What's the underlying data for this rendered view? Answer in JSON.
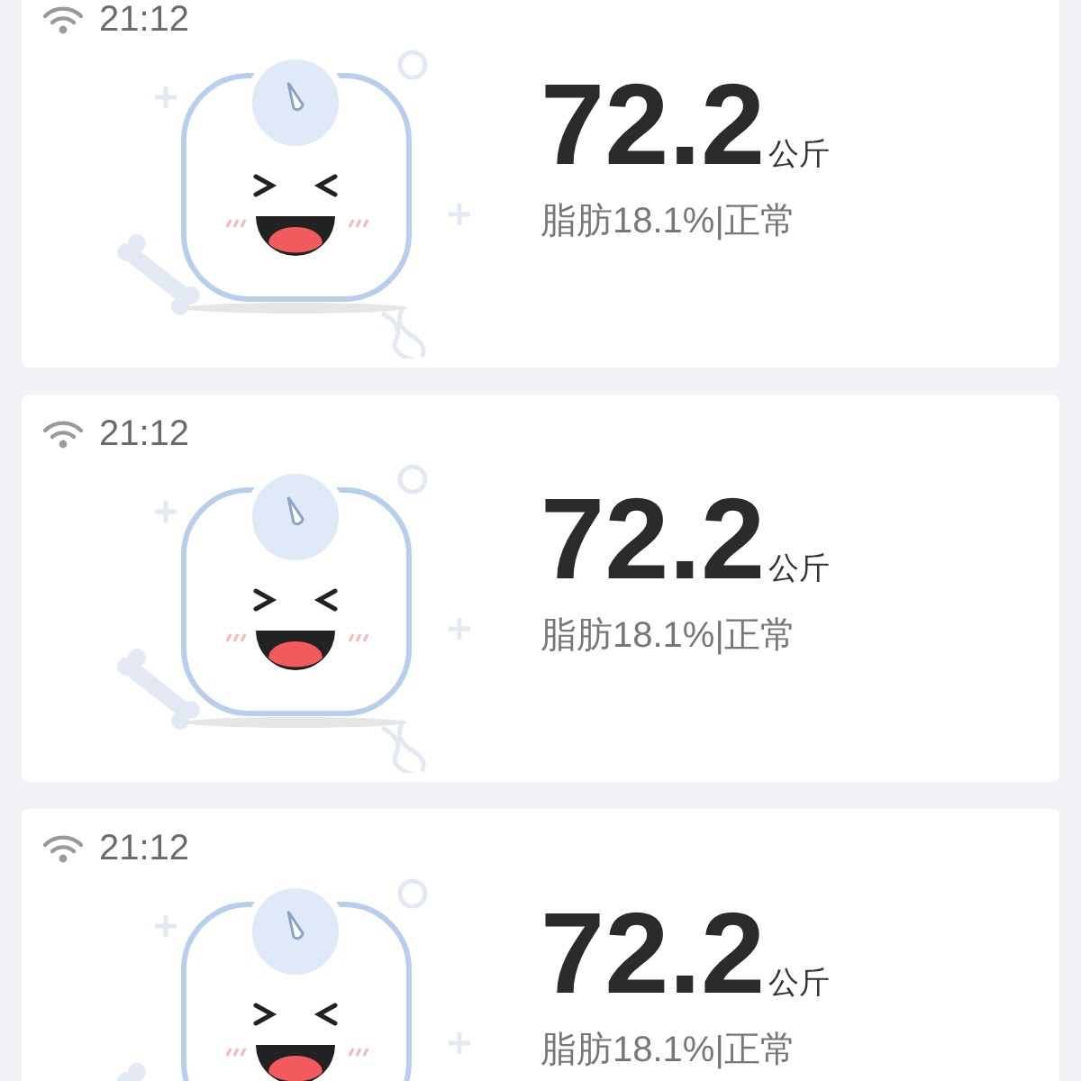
{
  "records": [
    {
      "time": "21:12",
      "weight": "72.2",
      "unit": "公斤",
      "detail": "脂肪18.1%|正常"
    },
    {
      "time": "21:12",
      "weight": "72.2",
      "unit": "公斤",
      "detail": "脂肪18.1%|正常"
    },
    {
      "time": "21:12",
      "weight": "72.2",
      "unit": "公斤",
      "detail": "脂肪18.1%|正常"
    }
  ]
}
